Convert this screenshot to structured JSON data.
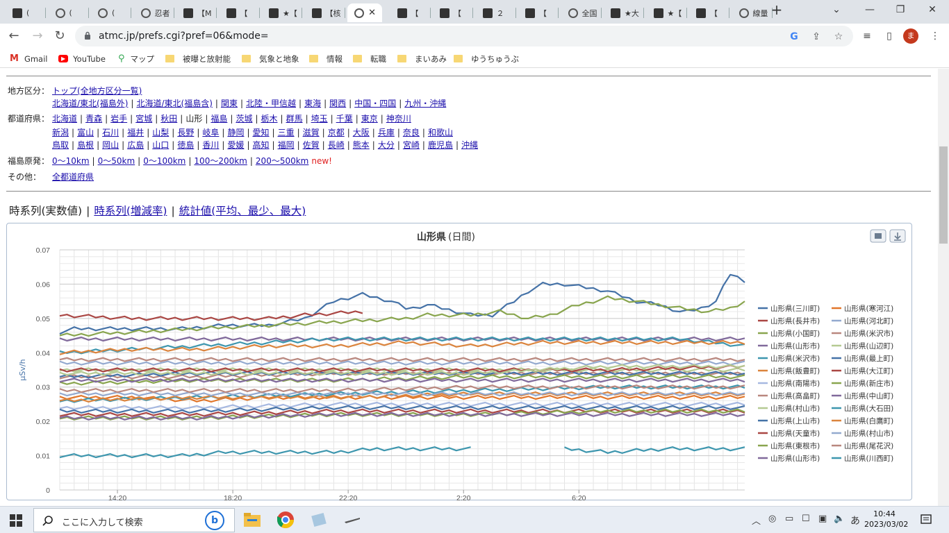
{
  "browser": {
    "tabs": [
      {
        "label": "(",
        "icon": "app-icon"
      },
      {
        "label": "(",
        "icon": "globe-icon"
      },
      {
        "label": "(",
        "icon": "globe-icon"
      },
      {
        "label": "忍者",
        "icon": "globe-icon"
      },
      {
        "label": "【M",
        "icon": "app-icon"
      },
      {
        "label": "【",
        "icon": "app-icon"
      },
      {
        "label": "★【",
        "icon": "app-icon"
      },
      {
        "label": "【核",
        "icon": "app-icon"
      },
      {
        "label": "",
        "icon": "globe-icon",
        "active": true
      },
      {
        "label": "【",
        "icon": "app-icon"
      },
      {
        "label": "【",
        "icon": "app-icon"
      },
      {
        "label": "２",
        "icon": "app-icon"
      },
      {
        "label": "【",
        "icon": "app-icon"
      },
      {
        "label": "全国",
        "icon": "globe-icon"
      },
      {
        "label": "★大",
        "icon": "app-icon"
      },
      {
        "label": "★【",
        "icon": "app-icon"
      },
      {
        "label": "【",
        "icon": "app-icon"
      },
      {
        "label": "線量",
        "icon": "globe-icon"
      }
    ],
    "url": "atmc.jp/prefs.cgi?pref=06&mode=",
    "avatar_letter": "ま",
    "bookmarks": [
      {
        "label": "Gmail",
        "icon": "gmail-icon"
      },
      {
        "label": "YouTube",
        "icon": "youtube-icon"
      },
      {
        "label": "マップ",
        "icon": "maps-icon"
      },
      {
        "label": "被曝と放射能",
        "icon": "folder-icon"
      },
      {
        "label": "気象と地象",
        "icon": "folder-icon"
      },
      {
        "label": "情報",
        "icon": "folder-icon"
      },
      {
        "label": "転職",
        "icon": "folder-icon"
      },
      {
        "label": "まいあみ",
        "icon": "folder-icon"
      },
      {
        "label": "ゆうちゅうぶ",
        "icon": "folder-icon"
      }
    ]
  },
  "page": {
    "region": {
      "label": "地方区分：",
      "line1": [
        "トップ(全地方区分一覧)"
      ],
      "line2": [
        "北海道/東北(福島外)",
        "北海道/東北(福島含)",
        "関東",
        "北陸・甲信越",
        "東海",
        "関西",
        "中国・四国",
        "九州・沖縄"
      ]
    },
    "prefs": {
      "label": "都道府県：",
      "line1": [
        "北海道",
        "青森",
        "岩手",
        "宮城",
        "秋田",
        "山形",
        "福島",
        "茨城",
        "栃木",
        "群馬",
        "埼玉",
        "千葉",
        "東京",
        "神奈川"
      ],
      "line2": [
        "新潟",
        "富山",
        "石川",
        "福井",
        "山梨",
        "長野",
        "岐阜",
        "静岡",
        "愛知",
        "三重",
        "滋賀",
        "京都",
        "大阪",
        "兵庫",
        "奈良",
        "和歌山"
      ],
      "line3": [
        "鳥取",
        "島根",
        "岡山",
        "広島",
        "山口",
        "徳島",
        "香川",
        "愛媛",
        "高知",
        "福岡",
        "佐賀",
        "長崎",
        "熊本",
        "大分",
        "宮崎",
        "鹿児島",
        "沖縄"
      ],
      "current": "山形"
    },
    "fukushima": {
      "label": "福島原発：",
      "links": [
        "0〜10km",
        "0〜50km",
        "0〜100km",
        "100〜200km",
        "200〜500km"
      ],
      "new_label": "new!"
    },
    "other": {
      "label": "その他：",
      "links": [
        "全都道府県"
      ]
    },
    "views": {
      "current": "時系列(実数値)",
      "links": [
        "時系列(増減率)",
        "統計値(平均、最少、最大)"
      ],
      "separator": "|"
    }
  },
  "chart_data": {
    "type": "line",
    "title": "山形県",
    "subtitle": "(日間)",
    "ylabel": "μSv/h",
    "xlabel": "",
    "ylim": [
      0,
      0.07
    ],
    "yticks": [
      "0.07",
      "0.06",
      "0.05",
      "0.04",
      "0.03",
      "0.02",
      "0.01",
      "0"
    ],
    "x_ticks": [
      "14:20",
      "18:20",
      "22:20",
      "2:20",
      "6:20"
    ],
    "x_tick_index": [
      8,
      24,
      40,
      56,
      72
    ],
    "n_points": 96,
    "grid": true,
    "legend_position": "right",
    "series": [
      {
        "name": "山形県(三川町)",
        "color": "#4572A7",
        "keys": [
          [
            0,
            0.046
          ],
          [
            2,
            0.047
          ],
          [
            8,
            0.047
          ],
          [
            12,
            0.047
          ],
          [
            18,
            0.047
          ],
          [
            24,
            0.048
          ],
          [
            30,
            0.048
          ],
          [
            36,
            0.05
          ],
          [
            40,
            0.055
          ],
          [
            44,
            0.057
          ],
          [
            48,
            0.055
          ],
          [
            50,
            0.053
          ],
          [
            52,
            0.053
          ],
          [
            54,
            0.054
          ],
          [
            56,
            0.053
          ],
          [
            60,
            0.051
          ],
          [
            63,
            0.051
          ],
          [
            66,
            0.055
          ],
          [
            68,
            0.058
          ],
          [
            70,
            0.06
          ],
          [
            74,
            0.06
          ],
          [
            77,
            0.059
          ],
          [
            80,
            0.058
          ],
          [
            84,
            0.055
          ],
          [
            87,
            0.054
          ],
          [
            90,
            0.052
          ],
          [
            92,
            0.052
          ],
          [
            94,
            0.053
          ],
          [
            96,
            0.055
          ],
          [
            98,
            0.063
          ],
          [
            100,
            0.061
          ]
        ]
      },
      {
        "name": "山形県(寒河江)",
        "color": "#E2762A",
        "keys": [
          [
            0,
            0.027
          ],
          [
            10,
            0.027
          ],
          [
            20,
            0.026
          ],
          [
            30,
            0.027
          ],
          [
            40,
            0.027
          ],
          [
            50,
            0.027
          ],
          [
            60,
            0.027
          ],
          [
            70,
            0.027
          ],
          [
            80,
            0.027
          ],
          [
            90,
            0.027
          ],
          [
            100,
            0.027
          ]
        ]
      },
      {
        "name": "山形県(長井市)",
        "color": "#AA4643",
        "keys": [
          [
            0,
            0.051
          ],
          [
            10,
            0.05
          ],
          [
            20,
            0.05
          ],
          [
            30,
            0.05
          ],
          [
            36,
            0.051
          ],
          [
            44,
            0.052
          ]
        ]
      },
      {
        "name": "山形県(河北町)",
        "color": "#93A9CF",
        "keys": [
          [
            0,
            0.037
          ],
          [
            10,
            0.037
          ],
          [
            20,
            0.037
          ],
          [
            30,
            0.037
          ],
          [
            40,
            0.037
          ],
          [
            50,
            0.037
          ],
          [
            60,
            0.037
          ],
          [
            70,
            0.037
          ],
          [
            80,
            0.037
          ],
          [
            90,
            0.037
          ],
          [
            100,
            0.037
          ]
        ]
      },
      {
        "name": "山形県(小国町)",
        "color": "#89A54E",
        "keys": [
          [
            0,
            0.045
          ],
          [
            10,
            0.046
          ],
          [
            20,
            0.047
          ],
          [
            30,
            0.048
          ],
          [
            40,
            0.049
          ],
          [
            50,
            0.05
          ],
          [
            54,
            0.051
          ],
          [
            60,
            0.051
          ],
          [
            64,
            0.052
          ],
          [
            68,
            0.05
          ],
          [
            72,
            0.051
          ],
          [
            76,
            0.054
          ],
          [
            80,
            0.056
          ],
          [
            84,
            0.055
          ],
          [
            90,
            0.053
          ],
          [
            95,
            0.052
          ],
          [
            98,
            0.053
          ],
          [
            100,
            0.055
          ]
        ]
      },
      {
        "name": "山形県(米沢市)",
        "color": "#B9877E",
        "keys": [
          [
            0,
            0.033
          ],
          [
            20,
            0.033
          ],
          [
            40,
            0.034
          ],
          [
            60,
            0.034
          ],
          [
            80,
            0.034
          ],
          [
            100,
            0.034
          ]
        ]
      },
      {
        "name": "山形県(山形市)",
        "color": "#80699B",
        "keys": [
          [
            0,
            0.044
          ],
          [
            20,
            0.044
          ],
          [
            40,
            0.044
          ],
          [
            60,
            0.044
          ],
          [
            80,
            0.044
          ],
          [
            100,
            0.044
          ]
        ]
      },
      {
        "name": "山形県(山辺町)",
        "color": "#B5CA92",
        "keys": [
          [
            0,
            0.035
          ],
          [
            20,
            0.035
          ],
          [
            40,
            0.035
          ],
          [
            60,
            0.035
          ],
          [
            80,
            0.035
          ],
          [
            100,
            0.035
          ]
        ]
      },
      {
        "name": "山形県(米沢市)",
        "color": "#3D96AE",
        "keys": [
          [
            0,
            0.04
          ],
          [
            10,
            0.041
          ],
          [
            20,
            0.042
          ],
          [
            30,
            0.043
          ],
          [
            40,
            0.044
          ],
          [
            50,
            0.044
          ],
          [
            60,
            0.044
          ],
          [
            70,
            0.044
          ],
          [
            80,
            0.044
          ],
          [
            90,
            0.044
          ],
          [
            100,
            0.042
          ]
        ]
      },
      {
        "name": "山形県(最上町)",
        "color": "#4572A7",
        "keys": [
          [
            0,
            0.033
          ],
          [
            20,
            0.034
          ],
          [
            40,
            0.034
          ],
          [
            60,
            0.034
          ],
          [
            80,
            0.034
          ],
          [
            100,
            0.034
          ]
        ]
      },
      {
        "name": "山形県(飯豊町)",
        "color": "#DB843D",
        "keys": [
          [
            0,
            0.04
          ],
          [
            10,
            0.041
          ],
          [
            20,
            0.041
          ],
          [
            30,
            0.042
          ],
          [
            40,
            0.042
          ],
          [
            50,
            0.043
          ],
          [
            60,
            0.042
          ],
          [
            70,
            0.043
          ],
          [
            80,
            0.043
          ],
          [
            90,
            0.043
          ],
          [
            100,
            0.043
          ]
        ]
      },
      {
        "name": "山形県(大江町)",
        "color": "#AA4643",
        "keys": [
          [
            0,
            0.035
          ],
          [
            20,
            0.035
          ],
          [
            40,
            0.035
          ],
          [
            60,
            0.035
          ],
          [
            80,
            0.035
          ],
          [
            100,
            0.036
          ]
        ]
      },
      {
        "name": "山形県(南陽市)",
        "color": "#A6B8E0",
        "keys": [
          [
            0,
            0.024
          ],
          [
            20,
            0.024
          ],
          [
            40,
            0.025
          ],
          [
            60,
            0.025
          ],
          [
            80,
            0.025
          ],
          [
            100,
            0.025
          ]
        ]
      },
      {
        "name": "山形県(新庄市)",
        "color": "#89A54E",
        "keys": [
          [
            0,
            0.031
          ],
          [
            20,
            0.032
          ],
          [
            40,
            0.032
          ],
          [
            60,
            0.033
          ],
          [
            80,
            0.033
          ],
          [
            100,
            0.033
          ]
        ]
      },
      {
        "name": "山形県(高畠町)",
        "color": "#B9877E",
        "keys": [
          [
            0,
            0.038
          ],
          [
            20,
            0.038
          ],
          [
            40,
            0.038
          ],
          [
            60,
            0.038
          ],
          [
            80,
            0.038
          ],
          [
            100,
            0.038
          ]
        ]
      },
      {
        "name": "山形県(中山町)",
        "color": "#80699B",
        "keys": [
          [
            0,
            0.032
          ],
          [
            20,
            0.032
          ],
          [
            40,
            0.032
          ],
          [
            60,
            0.032
          ],
          [
            80,
            0.032
          ],
          [
            100,
            0.032
          ]
        ]
      },
      {
        "name": "山形県(村山市)",
        "color": "#B5CA92",
        "keys": [
          [
            0,
            0.034
          ],
          [
            20,
            0.034
          ],
          [
            40,
            0.034
          ],
          [
            60,
            0.034
          ],
          [
            80,
            0.036
          ],
          [
            100,
            0.036
          ]
        ]
      },
      {
        "name": "山形県(大石田)",
        "color": "#3D96AE",
        "keys": [
          [
            0,
            0.026
          ],
          [
            20,
            0.027
          ],
          [
            40,
            0.028
          ],
          [
            60,
            0.029
          ],
          [
            80,
            0.03
          ],
          [
            100,
            0.03
          ]
        ]
      },
      {
        "name": "山形県(上山市)",
        "color": "#4572A7",
        "keys": [
          [
            0,
            0.023
          ],
          [
            20,
            0.023
          ],
          [
            40,
            0.024
          ],
          [
            60,
            0.024
          ],
          [
            80,
            0.024
          ],
          [
            100,
            0.024
          ]
        ]
      },
      {
        "name": "山形県(白鷹町)",
        "color": "#DB843D",
        "keys": [
          [
            0,
            0.026
          ],
          [
            20,
            0.027
          ],
          [
            40,
            0.027
          ],
          [
            60,
            0.028
          ],
          [
            80,
            0.028
          ],
          [
            100,
            0.028
          ]
        ]
      },
      {
        "name": "山形県(天童市)",
        "color": "#AA4643",
        "keys": [
          [
            0,
            0.022
          ],
          [
            20,
            0.022
          ],
          [
            40,
            0.023
          ],
          [
            60,
            0.023
          ],
          [
            80,
            0.023
          ],
          [
            100,
            0.023
          ]
        ]
      },
      {
        "name": "山形県(村山市)",
        "color": "#93A9CF",
        "keys": [
          [
            0,
            0.028
          ],
          [
            20,
            0.028
          ],
          [
            40,
            0.028
          ],
          [
            60,
            0.028
          ],
          [
            80,
            0.028
          ],
          [
            100,
            0.028
          ]
        ]
      },
      {
        "name": "山形県(東根市)",
        "color": "#89A54E",
        "keys": [
          [
            0,
            0.021
          ],
          [
            20,
            0.021
          ],
          [
            40,
            0.022
          ],
          [
            60,
            0.022
          ],
          [
            80,
            0.023
          ],
          [
            100,
            0.023
          ]
        ]
      },
      {
        "name": "山形県(尾花沢)",
        "color": "#B9877E",
        "keys": [
          [
            0,
            0.029
          ],
          [
            20,
            0.029
          ],
          [
            40,
            0.029
          ],
          [
            60,
            0.03
          ],
          [
            80,
            0.03
          ],
          [
            100,
            0.03
          ]
        ]
      },
      {
        "name": "山形県(山形市)",
        "color": "#80699B",
        "keys": [
          [
            0,
            0.021
          ],
          [
            20,
            0.021
          ],
          [
            40,
            0.022
          ],
          [
            60,
            0.022
          ],
          [
            80,
            0.022
          ],
          [
            100,
            0.022
          ]
        ]
      },
      {
        "name": "山形県(川西町)",
        "color": "#3D96AE",
        "keys": [
          [
            0,
            0.01
          ],
          [
            18,
            0.01
          ],
          [
            24,
            0.011
          ],
          [
            40,
            0.011
          ],
          [
            46,
            0.012
          ],
          [
            60,
            0.012
          ]
        ],
        "keys2": [
          [
            74,
            0.012
          ],
          [
            80,
            0.011
          ],
          [
            88,
            0.012
          ],
          [
            100,
            0.012
          ]
        ]
      }
    ]
  },
  "taskbar": {
    "search_placeholder": "ここに入力して検索",
    "time": "10:44",
    "date": "2023/03/02",
    "ime": "あ"
  }
}
